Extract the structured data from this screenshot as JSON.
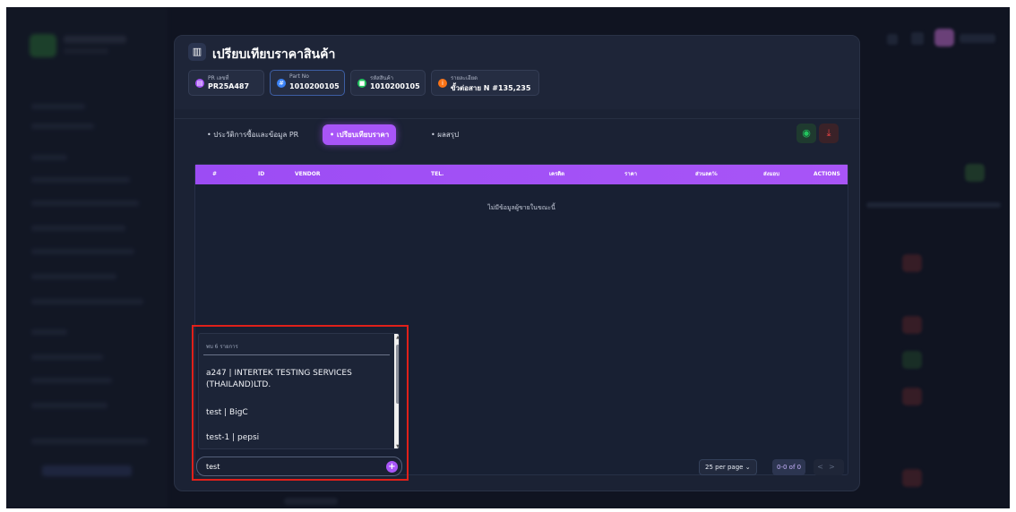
{
  "modal": {
    "title": "เปรียบเทียบราคาสินค้า",
    "title_icon": "chart-icon",
    "info_cards": [
      {
        "label": "PR เลขที่",
        "value": "PR25A487",
        "icon": "document-icon",
        "color": "#a855f7"
      },
      {
        "label": "Part No",
        "value": "1010200105",
        "icon": "hash-icon",
        "color": "#3b82f6"
      },
      {
        "label": "รหัสสินค้า",
        "value": "1010200105",
        "icon": "box-icon",
        "color": "#22c55e"
      },
      {
        "label": "รายละเอียด",
        "value": "ขั้วต่อสาย N #135,235",
        "icon": "info-icon",
        "color": "#f97316"
      }
    ],
    "tabs": [
      {
        "label": "• ประวัติการซื้อและข้อมูล PR",
        "active": false
      },
      {
        "label": "• เปรียบเทียบราคา",
        "active": true
      },
      {
        "label": "• ผลสรุป",
        "active": false
      }
    ],
    "toolbar": {
      "view_icon": "eye-icon",
      "download_icon": "download-icon"
    }
  },
  "grid": {
    "columns": [
      "#",
      "ID",
      "VENDOR",
      "TEL.",
      "เครดิต",
      "ราคา",
      "ส่วนลด%",
      "ส่งมอบ",
      "ACTIONS"
    ],
    "empty_message": "ไม่มีข้อมูลผู้ขายในขณะนี้",
    "footer": {
      "per_page": "25 per page",
      "pager_info": "0-0 of 0",
      "prev": "<",
      "next": ">"
    }
  },
  "dropdown": {
    "count_text": "พบ 6 รายการ",
    "items": [
      "a247 | INTERTEK TESTING SERVICES (THAILAND)LTD.",
      "test | BigC",
      "test-1 | pepsi"
    ]
  },
  "search": {
    "value": "test",
    "add_icon": "plus-icon"
  },
  "colors": {
    "accent": "#a855f7",
    "highlight": "#e0201a",
    "modal_bg": "#1b2234"
  }
}
